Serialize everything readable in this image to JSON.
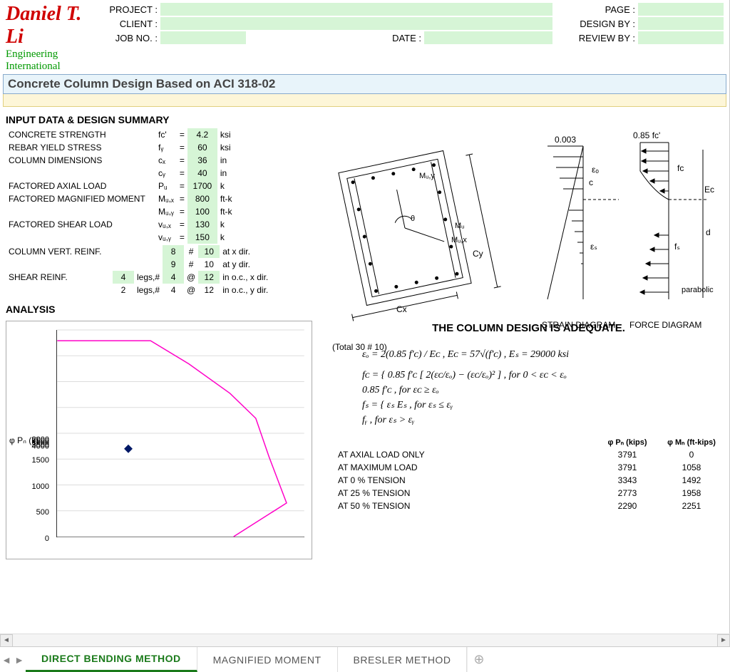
{
  "logo": {
    "name": "Daniel T. Li",
    "sub": "Engineering International"
  },
  "hdr": {
    "project_lbl": "PROJECT :",
    "client_lbl": "CLIENT :",
    "jobno_lbl": "JOB NO. :",
    "date_lbl": "DATE :",
    "page_lbl": "PAGE :",
    "designby_lbl": "DESIGN BY :",
    "reviewby_lbl": "REVIEW BY :",
    "project": "",
    "client": "",
    "jobno": "",
    "date": "",
    "page": "",
    "designby": "",
    "reviewby": ""
  },
  "title": "Concrete Column Design Based on ACI 318-02",
  "sections": {
    "input": "INPUT DATA & DESIGN SUMMARY",
    "analysis": "ANALYSIS"
  },
  "inp": [
    {
      "label": "CONCRETE STRENGTH",
      "sym": "fᴄ'",
      "val": "4.2",
      "unit": "ksi",
      "eq": "="
    },
    {
      "label": "REBAR YIELD STRESS",
      "sym": "fᵧ",
      "val": "60",
      "unit": "ksi",
      "eq": "="
    },
    {
      "label": "COLUMN DIMENSIONS",
      "sym": "cₓ",
      "val": "36",
      "unit": "in",
      "eq": "="
    },
    {
      "label": "",
      "sym": "cᵧ",
      "val": "40",
      "unit": "in",
      "eq": "="
    },
    {
      "label": "FACTORED AXIAL LOAD",
      "sym": "Pᵤ",
      "val": "1700",
      "unit": "k",
      "eq": "="
    },
    {
      "label": "FACTORED MAGNIFIED MOMENT",
      "sym": "Mᵤ,ₓ",
      "val": "800",
      "unit": "ft-k",
      "eq": "="
    },
    {
      "label": "",
      "sym": "Mᵤ,ᵧ",
      "val": "100",
      "unit": "ft-k",
      "eq": "="
    },
    {
      "label": "FACTORED SHEAR LOAD",
      "sym": "vᵤ,ₓ",
      "val": "130",
      "unit": "k",
      "eq": "="
    },
    {
      "label": "",
      "sym": "vᵤ,ᵧ",
      "val": "150",
      "unit": "k",
      "eq": "="
    }
  ],
  "reinf": {
    "vert_lbl": "COLUMN VERT. REINF.",
    "shear_lbl": "SHEAR REINF.",
    "rows": [
      {
        "a": "8",
        "b": "#",
        "c": "10",
        "d": "at x dir.",
        "agr": true,
        "cgr": true
      },
      {
        "a": "9",
        "b": "#",
        "c": "10",
        "d": "at y dir.",
        "agr": true,
        "cgr": false
      },
      {
        "a": "4",
        "b": "@",
        "c": "12",
        "d": "in o.c., x dir.",
        "agr": true,
        "cgr": true,
        "pre": "4",
        "preu": "legs,#"
      },
      {
        "a": "4",
        "b": "@",
        "c": "12",
        "d": "in o.c., y dir.",
        "agr": false,
        "cgr": false,
        "pre": "2",
        "preu": "legs,#"
      }
    ],
    "total": "(Total 30 # 10)"
  },
  "adequate": "THE COLUMN DESIGN IS ADEQUATE.",
  "diag_labels": {
    "strain": "STRAIN  DIAGRAM",
    "force": "FORCE  DIAGRAM",
    "top_strain": "0.003",
    "top_force": "0.85  fᴄ'",
    "eps_o": "εₒ",
    "eps_s": "εₛ",
    "fc": "fᴄ",
    "fs": "fₛ",
    "c": "c",
    "d": "d",
    "Ec": "Eᴄ",
    "parabolic": "parabolic",
    "cx": "Cx",
    "cy": "Cy",
    "mu": "Mᵤ",
    "mux": "Mᵤ,x",
    "muy": "Mᵤ,y",
    "theta": "θ"
  },
  "math": {
    "l1": "εₒ = 2(0.85 f'ᴄ) / Eᴄ  ,  Eᴄ = 57√(f'ᴄ)  ,  Eₛ = 29000 ksi",
    "l2": "fᴄ = { 0.85 f'ᴄ [ 2(εᴄ/εₒ) − (εᴄ/εₒ)² ] ,  for  0 < εᴄ < εₒ",
    "l3": "        0.85 f'ᴄ  ,  for  εᴄ ≥ εₒ",
    "l4": "fₛ = { εₛ Eₛ ,  for  εₛ ≤ εᵧ",
    "l5": "        fᵧ  ,  for  εₛ > εᵧ"
  },
  "results": {
    "h1": "φ Pₙ (kips)",
    "h2": "φ Mₙ (ft-kips)",
    "rows": [
      {
        "lbl": "AT AXIAL LOAD ONLY",
        "p": "3791",
        "m": "0"
      },
      {
        "lbl": "AT MAXIMUM LOAD",
        "p": "3791",
        "m": "1058"
      },
      {
        "lbl": "AT 0 % TENSION",
        "p": "3343",
        "m": "1492"
      },
      {
        "lbl": "AT 25 % TENSION",
        "p": "2773",
        "m": "1958"
      },
      {
        "lbl": "AT 50 % TENSION",
        "p": "2290",
        "m": "2251"
      }
    ]
  },
  "chart_data": {
    "type": "line",
    "ylabel": "φ Pₙ (k)",
    "ylim": [
      0,
      4000
    ],
    "yticks": [
      0,
      500,
      1000,
      1500,
      2000,
      2500,
      3000,
      3500,
      4000
    ],
    "series": [
      {
        "name": "interaction",
        "color": "#ff00c8",
        "points": [
          [
            0,
            3791
          ],
          [
            1058,
            3791
          ],
          [
            1492,
            3343
          ],
          [
            1958,
            2773
          ],
          [
            2251,
            2290
          ],
          [
            2400,
            1550
          ],
          [
            2600,
            650
          ],
          [
            2000,
            0
          ]
        ]
      },
      {
        "name": "design-point",
        "color": "#001866",
        "type": "scatter",
        "points": [
          [
            806,
            1700
          ]
        ]
      }
    ],
    "xlim": [
      0,
      2800
    ]
  },
  "tabs": [
    {
      "label": "DIRECT BENDING METHOD",
      "active": true
    },
    {
      "label": "MAGNIFIED MOMENT",
      "active": false
    },
    {
      "label": "BRESLER METHOD",
      "active": false
    }
  ]
}
